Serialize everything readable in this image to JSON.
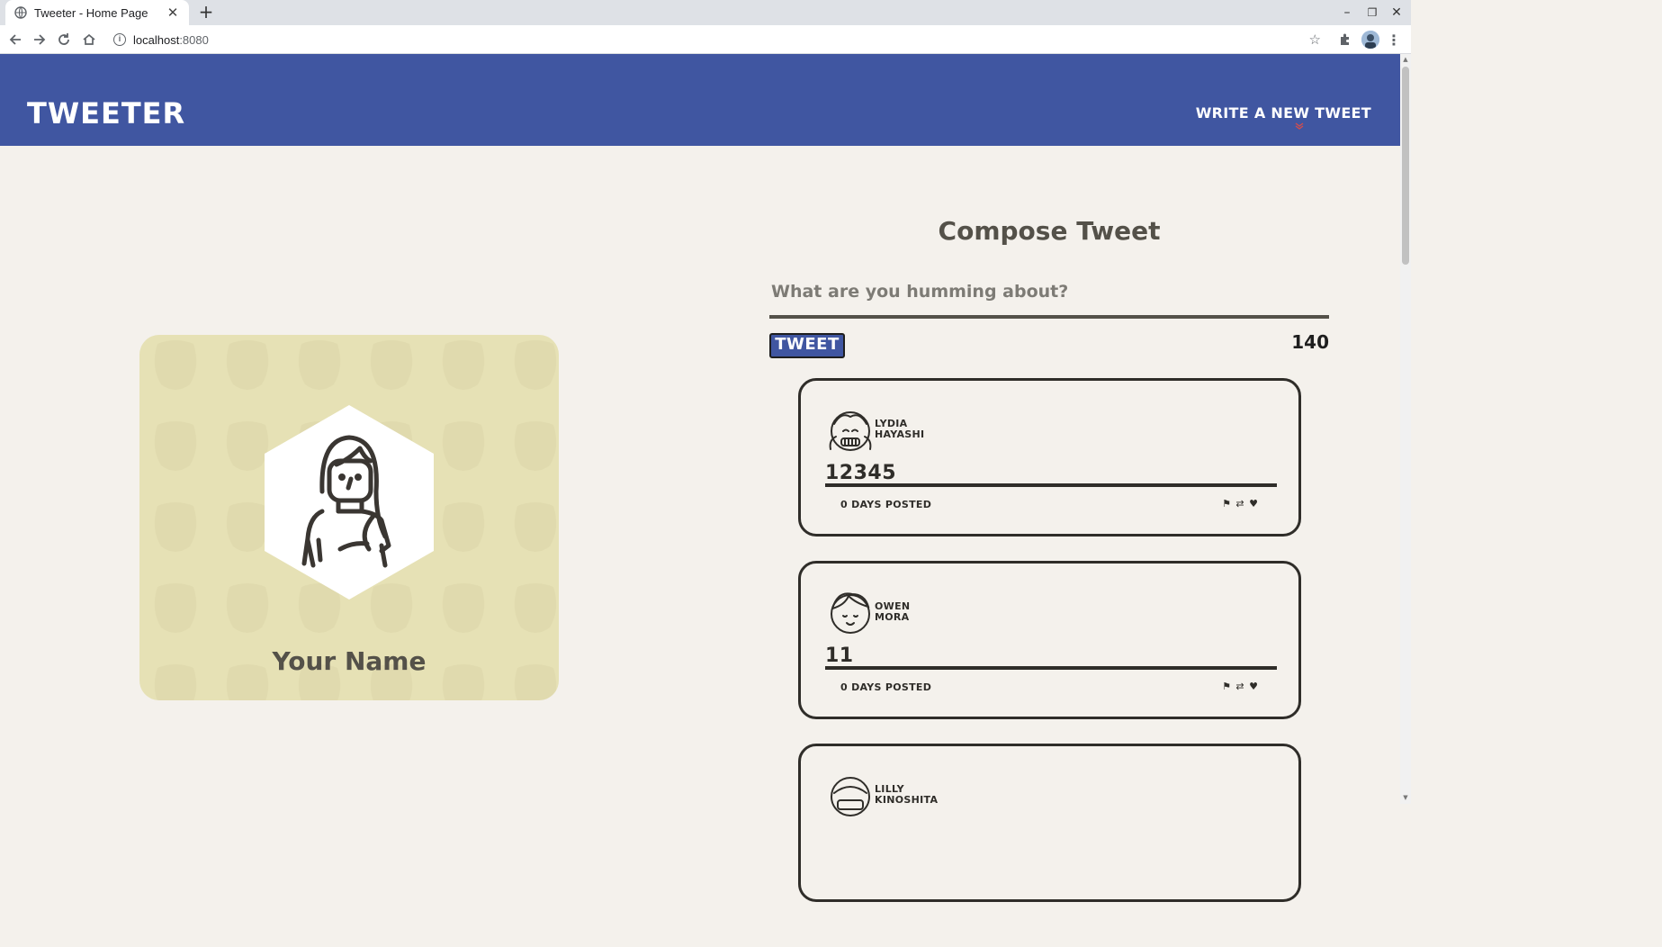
{
  "browser": {
    "tab_title": "Tweeter - Home Page",
    "url_host": "localhost",
    "url_port": ":8080"
  },
  "nav": {
    "brand": "TWEETER",
    "write_new": "WRITE A NEW TWEET"
  },
  "profile": {
    "name": "Your Name"
  },
  "compose": {
    "title": "Compose Tweet",
    "placeholder": "What are you humming about?",
    "button": "TWEET",
    "counter": "140"
  },
  "tweets": [
    {
      "first": "LYDIA",
      "last": "HAYASHI",
      "content": "12345",
      "posted": "0 DAYS POSTED"
    },
    {
      "first": "OWEN",
      "last": "MORA",
      "content": "11",
      "posted": "0 DAYS POSTED"
    },
    {
      "first": "LILLY",
      "last": "KINOSHITA",
      "content": "",
      "posted": ""
    }
  ],
  "colors": {
    "nav": "#4056a1",
    "background": "#f4f1ec",
    "profile_card": "#e6e1b5",
    "text_dark": "#545149",
    "accent_chevron": "#d14d4d"
  },
  "icons": [
    "globe-icon",
    "close-icon",
    "plus-icon",
    "back-icon",
    "forward-icon",
    "reload-icon",
    "home-icon",
    "info-icon",
    "star-icon",
    "extensions-icon",
    "profile-avatar",
    "menu-icon",
    "flag-icon",
    "retweet-icon",
    "heart-icon",
    "chevron-down-icon"
  ]
}
